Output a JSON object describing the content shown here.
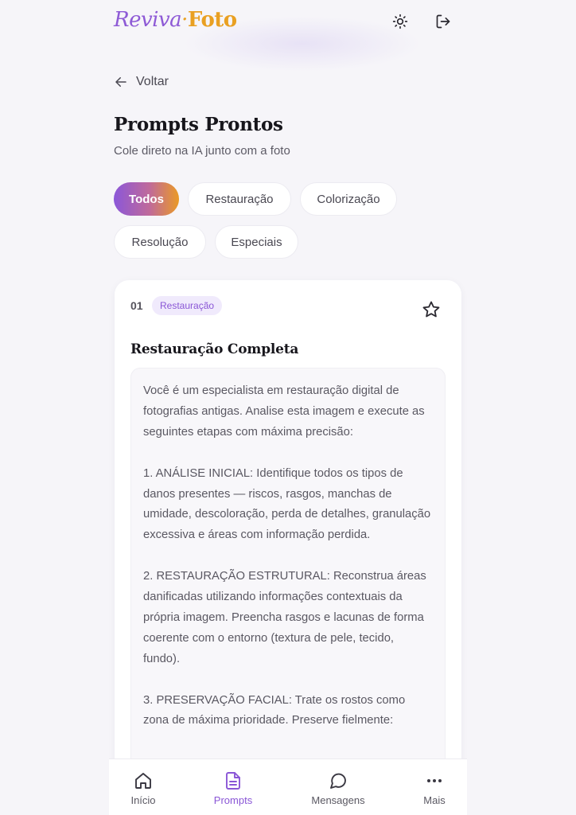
{
  "header": {
    "logo_part1": "Reviva",
    "logo_separator": "·",
    "logo_part2": "Foto",
    "theme_icon": "sun-icon",
    "logout_icon": "logout-icon"
  },
  "back": {
    "label": "Voltar",
    "icon": "arrow-left-icon"
  },
  "page": {
    "title": "Prompts Prontos",
    "subtitle": "Cole direto na IA junto com a foto"
  },
  "filters": [
    {
      "label": "Todos",
      "active": true
    },
    {
      "label": "Restauração",
      "active": false
    },
    {
      "label": "Colorização",
      "active": false
    },
    {
      "label": "Resolução",
      "active": false
    },
    {
      "label": "Especiais",
      "active": false
    }
  ],
  "card": {
    "number": "01",
    "tag": "Restauração",
    "favorite_icon": "star-outline-icon",
    "title": "Restauração Completa",
    "paragraphs": [
      "Você é um especialista em restauração digital de fotografias antigas. Analise esta imagem e execute as seguintes etapas com máxima precisão:",
      "1. ANÁLISE INICIAL: Identifique todos os tipos de danos presentes — riscos, rasgos, manchas de umidade, descoloração, perda de detalhes, granulação excessiva e áreas com informação perdida.",
      "2. RESTAURAÇÃO ESTRUTURAL: Reconstrua áreas danificadas utilizando informações contextuais da própria imagem. Preencha rasgos e lacunas de forma coerente com o entorno (textura de pele, tecido, fundo).",
      "3. PRESERVAÇÃO FACIAL: Trate os rostos como zona de máxima prioridade. Preserve fielmente:"
    ]
  },
  "nav": {
    "items": [
      {
        "label": "Início",
        "icon": "home-icon",
        "active": false
      },
      {
        "label": "Prompts",
        "icon": "document-icon",
        "active": true
      },
      {
        "label": "Mensagens",
        "icon": "chat-bubble-icon",
        "active": false
      },
      {
        "label": "Mais",
        "icon": "more-dots-icon",
        "active": false
      }
    ]
  },
  "colors": {
    "accent_purple": "#8a56d6",
    "accent_orange": "#e9a022",
    "background": "#f6f5f9"
  }
}
